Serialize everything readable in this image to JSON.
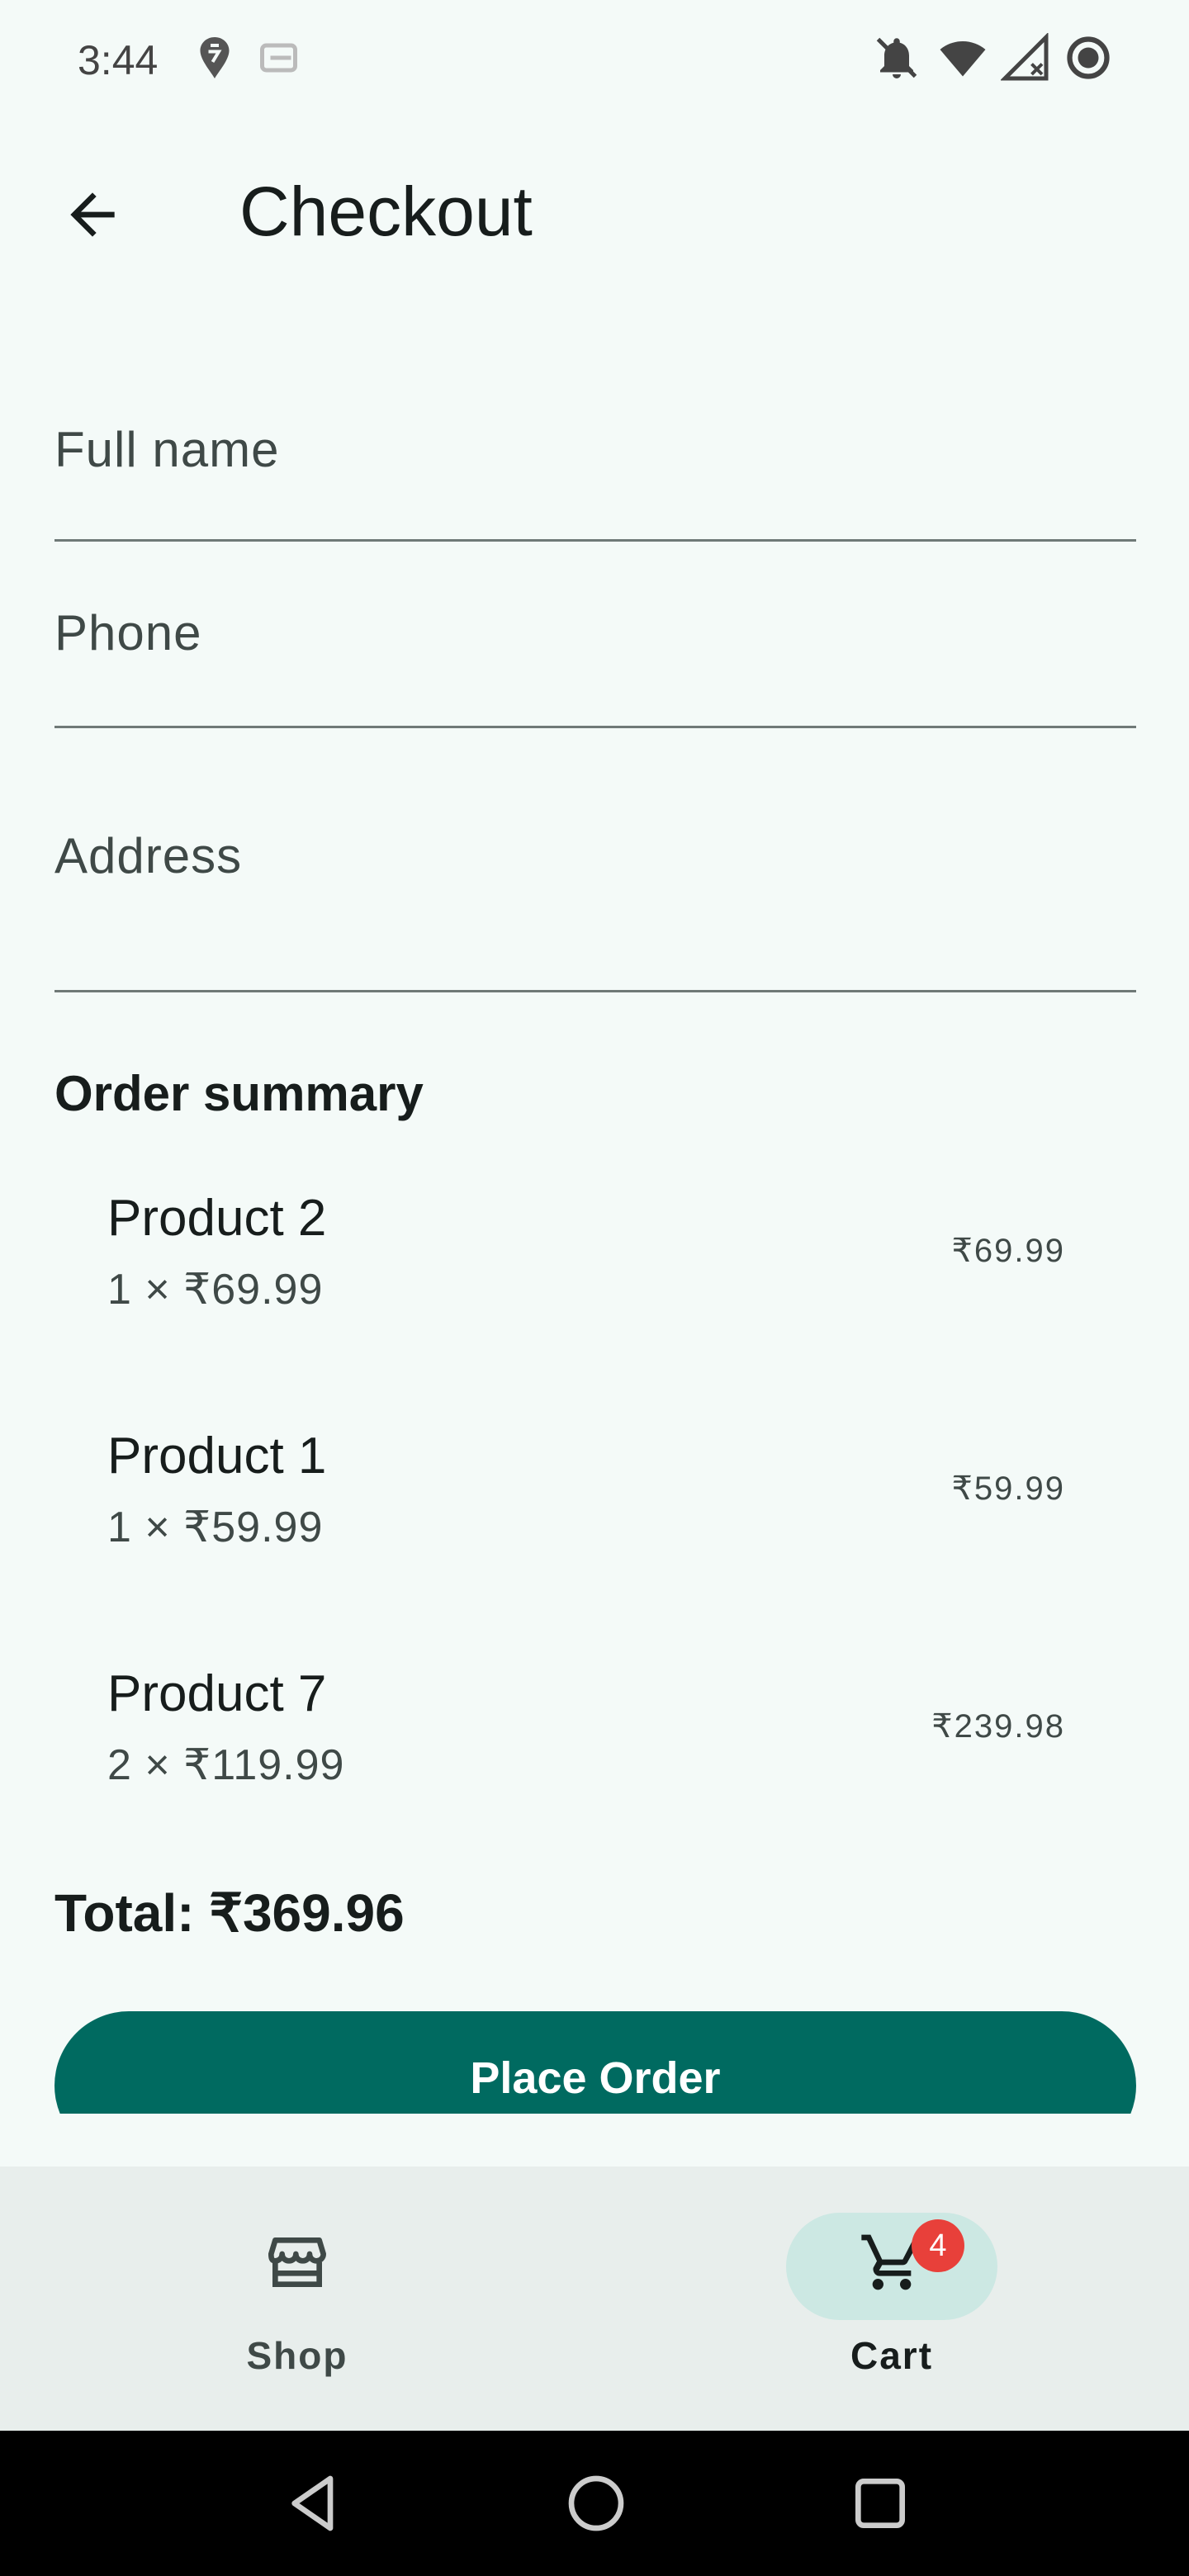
{
  "status_bar": {
    "time": "3:44",
    "icons": [
      "swiggy-icon",
      "dash-icon",
      "notifications-off-icon",
      "wifi-icon",
      "no-signal-icon",
      "record-icon"
    ]
  },
  "app_bar": {
    "title": "Checkout",
    "back_icon": "arrow-back-icon"
  },
  "form": {
    "full_name_label": "Full name",
    "phone_label": "Phone",
    "address_label": "Address"
  },
  "order_summary": {
    "title": "Order summary",
    "items": [
      {
        "name": "Product 2",
        "qty_line": "1 × ₹69.99",
        "price": "₹69.99"
      },
      {
        "name": "Product 1",
        "qty_line": "1 × ₹59.99",
        "price": "₹59.99"
      },
      {
        "name": "Product 7",
        "qty_line": "2 × ₹119.99",
        "price": "₹239.98"
      }
    ],
    "total": "Total: ₹369.96"
  },
  "place_order_label": "Place Order",
  "bottom_nav": {
    "items": [
      {
        "label": "Shop",
        "icon": "store-icon",
        "selected": false
      },
      {
        "label": "Cart",
        "icon": "cart-icon",
        "selected": true,
        "badge": "4"
      }
    ]
  },
  "colors": {
    "primary": "#006a60",
    "background": "#f4faf8",
    "nav_background": "#e8eeec",
    "nav_indicator": "#cce8e3",
    "badge": "#e8403a"
  }
}
